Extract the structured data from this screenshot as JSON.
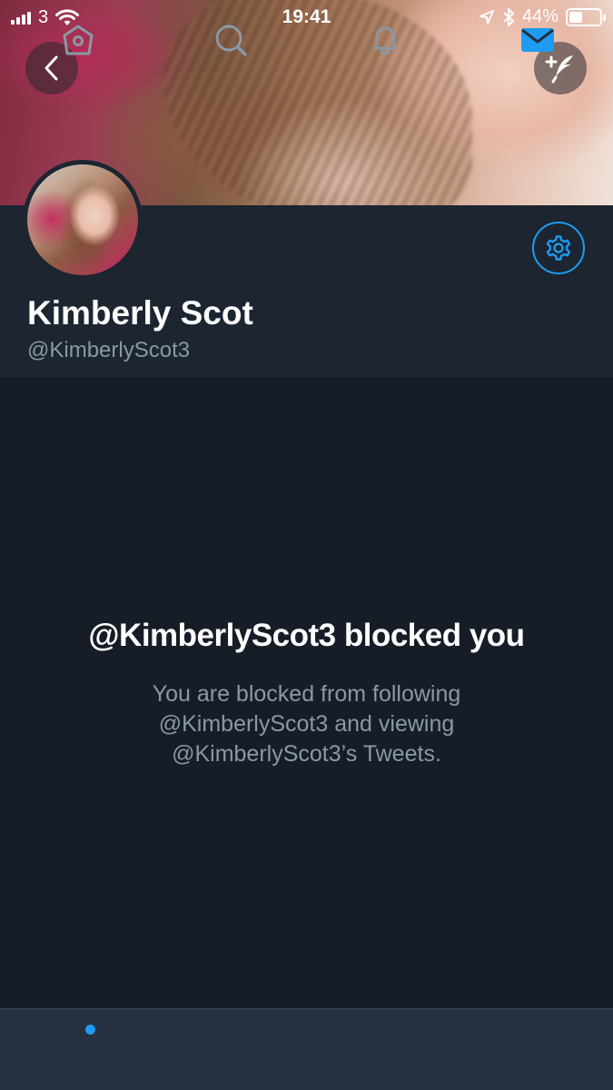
{
  "status_bar": {
    "carrier": "3",
    "time": "19:41",
    "battery": "44%",
    "battery_level": 0.44
  },
  "profile": {
    "display_name": "Kimberly Scot",
    "handle": "@KimberlyScot3"
  },
  "blocked": {
    "title": "@KimberlyScot3 blocked you",
    "description": "You are blocked from following @KimberlyScot3 and viewing @KimberlyScot3’s Tweets."
  },
  "icons": {
    "back": "chevron-left-icon",
    "compose": "compose-tweet-icon",
    "settings": "gear-icon",
    "home": "home-icon",
    "search": "search-icon",
    "notifications": "bell-icon",
    "messages": "mail-icon"
  },
  "colors": {
    "accent": "#1d9bf0",
    "background": "#161d26",
    "header_bg": "#1c2530",
    "tabbar_bg": "#253141",
    "secondary_text": "#8b98a5"
  }
}
